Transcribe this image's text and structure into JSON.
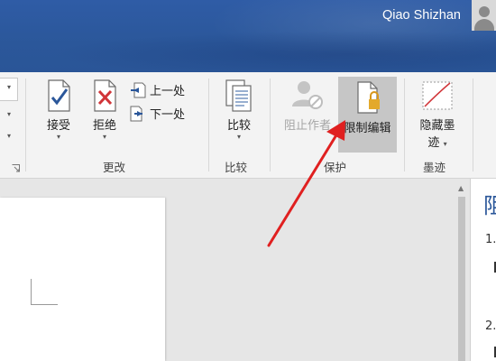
{
  "titlebar": {
    "user_name": "Qiao Shizhan"
  },
  "ribbon": {
    "changes_group": {
      "label": "更改",
      "accept": {
        "label": "接受"
      },
      "reject": {
        "label": "拒绝"
      },
      "previous": {
        "label": "上一处"
      },
      "next": {
        "label": "下一处"
      }
    },
    "compare_group": {
      "label": "比较",
      "compare": {
        "label": "比较"
      }
    },
    "protect_group": {
      "label": "保护",
      "block_authors": {
        "label": "阻止作者"
      },
      "restrict_editing": {
        "label": "限制编辑"
      }
    },
    "ink_group": {
      "label": "墨迹",
      "hide_ink": {
        "label_line1": "隐藏墨",
        "label_line2": "迹"
      }
    }
  },
  "nav_pane": {
    "heading": "阻",
    "items": [
      "1.",
      "2."
    ]
  },
  "colors": {
    "title_bar": "#2b579a",
    "annotation_arrow": "#e02020",
    "selected_button": "#c6c6c6"
  },
  "annotation": {
    "type": "red-arrow",
    "target": "restrict_editing"
  }
}
